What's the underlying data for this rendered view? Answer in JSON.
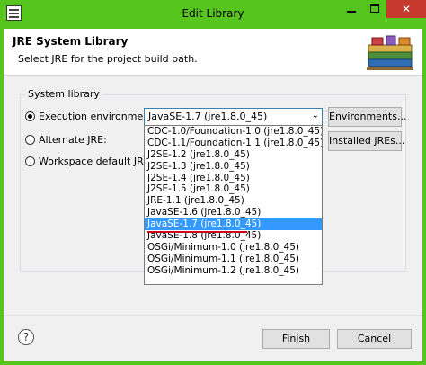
{
  "window": {
    "title": "Edit Library",
    "close_glyph": "✕"
  },
  "header": {
    "title": "JRE System Library",
    "description": "Select JRE for the project build path.",
    "icon": "library-books-icon"
  },
  "group": {
    "label": "System library"
  },
  "options": {
    "execution_env": {
      "label": "Execution environment:",
      "checked": true
    },
    "alternate_jre": {
      "label": "Alternate JRE:",
      "checked": false
    },
    "workspace_default": {
      "label": "Workspace default JRE (jre",
      "checked": false
    }
  },
  "combo": {
    "value": "JavaSE-1.7 (jre1.8.0_45)"
  },
  "dropdown": {
    "items": [
      "CDC-1.0/Foundation-1.0 (jre1.8.0_45)",
      "CDC-1.1/Foundation-1.1 (jre1.8.0_45)",
      "J2SE-1.2 (jre1.8.0_45)",
      "J2SE-1.3 (jre1.8.0_45)",
      "J2SE-1.4 (jre1.8.0_45)",
      "J2SE-1.5 (jre1.8.0_45)",
      "JRE-1.1 (jre1.8.0_45)",
      "JavaSE-1.6 (jre1.8.0_45)",
      "JavaSE-1.7 (jre1.8.0_45)",
      "JavaSE-1.8 (jre1.8.0_45)",
      "OSGi/Minimum-1.0 (jre1.8.0_45)",
      "OSGi/Minimum-1.1 (jre1.8.0_45)",
      "OSGi/Minimum-1.2 (jre1.8.0_45)"
    ],
    "selected_index": 8
  },
  "buttons": {
    "environments": "Environments...",
    "installed_jres": "Installed JREs...",
    "finish": "Finish",
    "cancel": "Cancel"
  },
  "help": {
    "glyph": "?"
  },
  "colors": {
    "titlebar": "#56c51e",
    "close": "#c7392d",
    "selection": "#3399ff",
    "annotation": "#d0021b"
  }
}
